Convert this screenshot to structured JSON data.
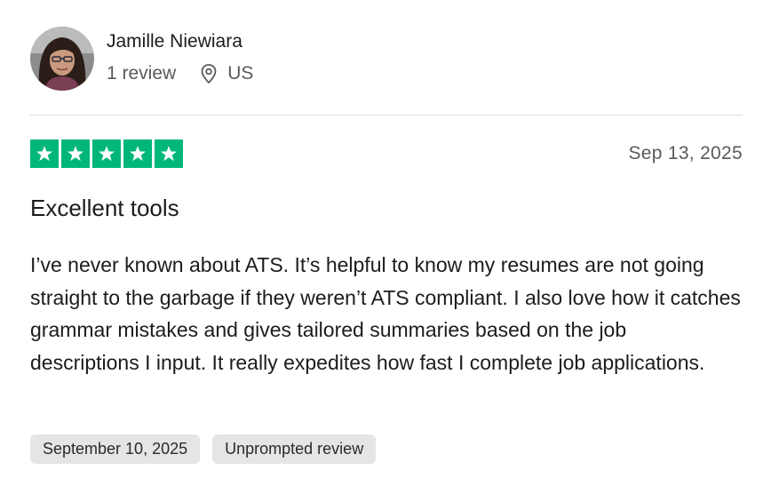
{
  "reviewer": {
    "name": "Jamille Niewiara",
    "review_count": "1 review",
    "location": "US",
    "avatar_icon": "user-photo"
  },
  "review": {
    "rating": 5,
    "max_rating": 5,
    "star_color": "#00b67a",
    "date": "Sep 13, 2025",
    "title": "Excellent tools",
    "body": "I’ve never known about ATS. It’s helpful to know my resumes are not going straight to the garbage if they weren’t ATS compliant. I also love how it catches grammar mistakes and gives tailored summaries based on the job descriptions I input. It really expedites how fast I complete job applications.",
    "experience_date": "September 10, 2025",
    "review_type": "Unprompted review"
  },
  "icons": {
    "location": "location-pin-icon",
    "star": "star-icon"
  }
}
